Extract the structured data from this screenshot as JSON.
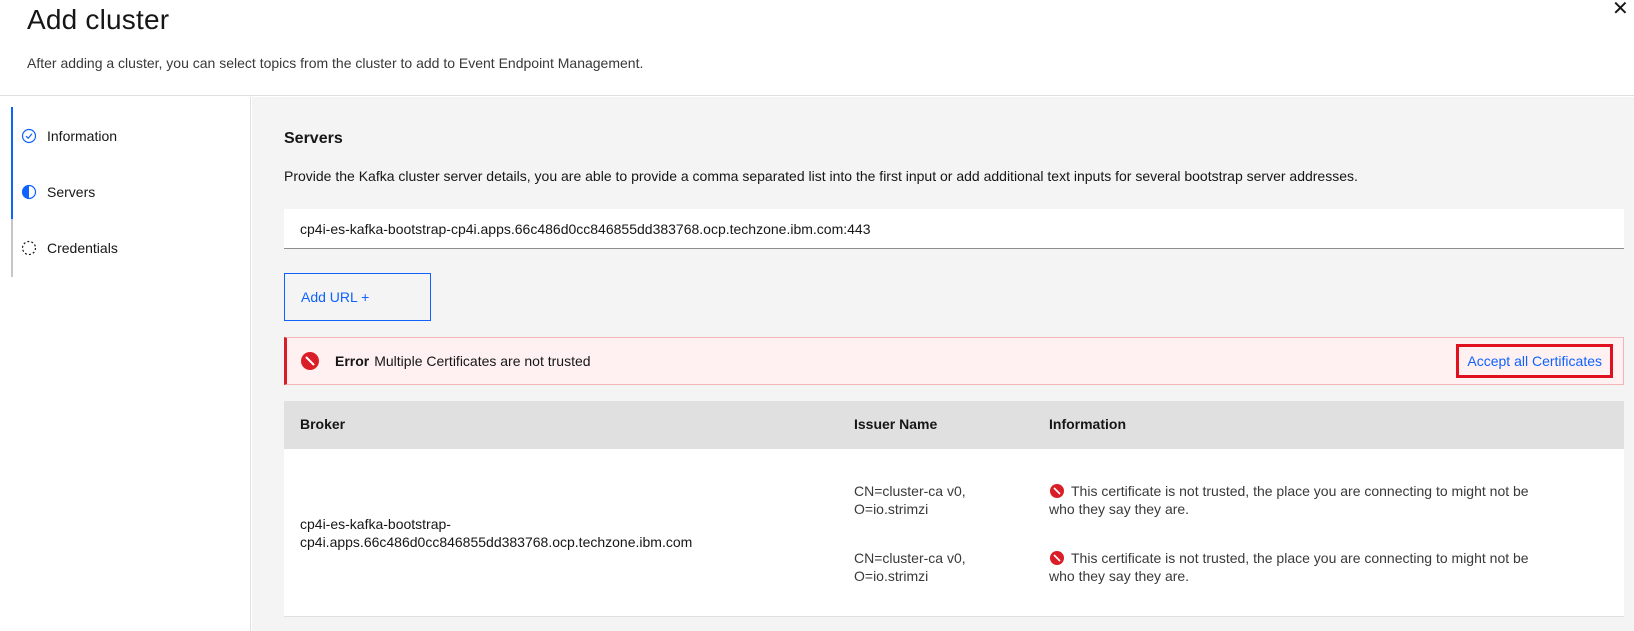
{
  "header": {
    "title": "Add cluster",
    "subtitle": "After adding a cluster, you can select topics from the cluster to add to Event Endpoint Management.",
    "close_icon": "close-icon"
  },
  "steps": [
    {
      "label": "Information",
      "state": "complete",
      "icon": "checkmark-outline-icon"
    },
    {
      "label": "Servers",
      "state": "current",
      "icon": "incomplete-half-icon"
    },
    {
      "label": "Credentials",
      "state": "incomplete",
      "icon": "circle-dash-icon"
    }
  ],
  "servers": {
    "title": "Servers",
    "description": "Provide the Kafka cluster server details, you are able to provide a comma separated list into the first input or add additional text inputs for several bootstrap server addresses.",
    "url_value": "cp4i-es-kafka-bootstrap-cp4i.apps.66c486d0cc846855dd383768.ocp.techzone.ibm.com:443",
    "add_url_label": "Add URL +"
  },
  "error": {
    "title": "Error",
    "message": "Multiple Certificates are not trusted",
    "action_label": "Accept all Certificates"
  },
  "table": {
    "headers": [
      "Broker",
      "Issuer Name",
      "Information"
    ],
    "broker": "cp4i-es-kafka-bootstrap-cp4i.apps.66c486d0cc846855dd383768.ocp.techzone.ibm.com",
    "certs": [
      {
        "issuer": "CN=cluster-ca v0, O=io.strimzi",
        "info": "This certificate is not trusted, the place you are connecting to might not be who they say they are."
      },
      {
        "issuer": "CN=cluster-ca v0, O=io.strimzi",
        "info": "This certificate is not trusted, the place you are connecting to might not be who they say they are."
      }
    ]
  },
  "colors": {
    "accent": "#0f62fe",
    "error": "#da1e28",
    "error_bg": "#fff1f1",
    "highlight": "#e0101e"
  }
}
